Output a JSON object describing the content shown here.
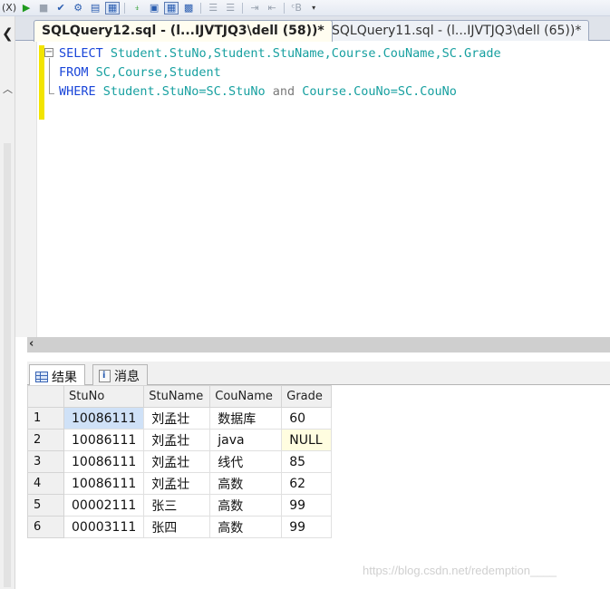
{
  "toolbar": {
    "menu_label": "(X)",
    "buttons": [
      "execute-icon",
      "stop-icon",
      "check-icon",
      "debug-icon",
      "results-to-text-icon",
      "results-to-grid-icon",
      "include-plan-icon",
      "query-options-icon",
      "comment-icon",
      "uncomment-icon",
      "indent-icon",
      "outdent-icon",
      "specify-values-icon"
    ]
  },
  "tabs": [
    {
      "label": "SQLQuery12.sql - (l...IJVTJQ3\\dell (58))*",
      "active": true
    },
    {
      "label": "SQLQuery11.sql - (l...IJVTJQ3\\dell (65))*",
      "active": false
    }
  ],
  "editor": {
    "line1": {
      "kw": "SELECT",
      "rest": " Student.StuNo,Student.StuName,Course.CouName,SC.Grade"
    },
    "line2": {
      "kw": "FROM",
      "rest": " SC,Course,Student"
    },
    "line3": {
      "kw": "WHERE",
      "a": " Student.StuNo=SC.StuNo ",
      "and": "and",
      "b": " Course.CouNo=SC.CouNo"
    }
  },
  "results_tabs": {
    "results": "结果",
    "messages": "消息"
  },
  "grid": {
    "columns": [
      "StuNo",
      "StuName",
      "CouName",
      "Grade"
    ],
    "rows": [
      {
        "n": "1",
        "StuNo": "10086111",
        "StuName": "刘孟壮",
        "CouName": "数据库",
        "Grade": "60"
      },
      {
        "n": "2",
        "StuNo": "10086111",
        "StuName": "刘孟壮",
        "CouName": "java",
        "Grade": "NULL"
      },
      {
        "n": "3",
        "StuNo": "10086111",
        "StuName": "刘孟壮",
        "CouName": "线代",
        "Grade": "85"
      },
      {
        "n": "4",
        "StuNo": "10086111",
        "StuName": "刘孟壮",
        "CouName": "高数",
        "Grade": "62"
      },
      {
        "n": "5",
        "StuNo": "00002111",
        "StuName": "张三",
        "CouName": "高数",
        "Grade": "99"
      },
      {
        "n": "6",
        "StuNo": "00003111",
        "StuName": "张四",
        "CouName": "高数",
        "Grade": "99"
      }
    ]
  },
  "watermark": "https://blog.csdn.net/redemption____"
}
